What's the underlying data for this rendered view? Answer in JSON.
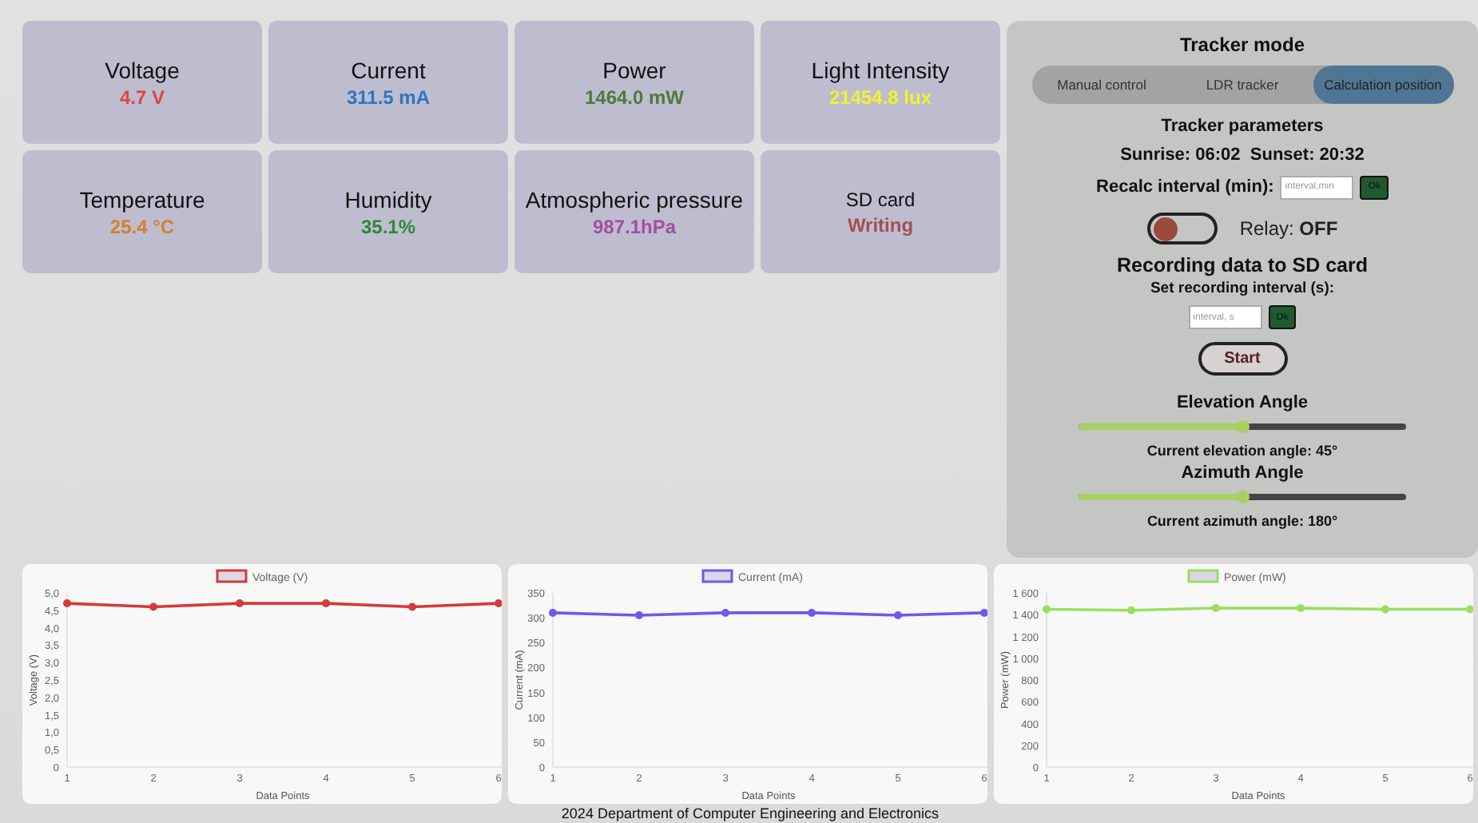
{
  "metrics": [
    {
      "label": "Voltage",
      "value": "4.7 V",
      "color": "#e04444"
    },
    {
      "label": "Current",
      "value": "311.5 mA",
      "color": "#2f74c4"
    },
    {
      "label": "Power",
      "value": "1464.0 mW",
      "color": "#4f7a3f"
    },
    {
      "label": "Light Intensity",
      "value": "21454.8 lux",
      "color": "#f2f230"
    },
    {
      "label": "Temperature",
      "value": "25.4 °C",
      "color": "#d5802a"
    },
    {
      "label": "Humidity",
      "value": "35.1%",
      "color": "#2e8a32"
    },
    {
      "label": "Atmospheric pressure",
      "value": "987.1hPa",
      "color": "#a44ea4"
    },
    {
      "label": "SD card",
      "value": "Writing",
      "color": "#a45050"
    }
  ],
  "tracker": {
    "title": "Tracker mode",
    "tabs": [
      {
        "label": "Manual control",
        "selected": false
      },
      {
        "label": "LDR tracker",
        "selected": false
      },
      {
        "label": "Calculation position",
        "selected": true
      }
    ],
    "parameters_title": "Tracker parameters",
    "sun_times": "Sunrise: 06:02  Sunset: 20:32",
    "recalc": {
      "label": "Recalc interval (min):",
      "placeholder": "interval,min",
      "button": "Ok"
    },
    "relay": {
      "label": "Relay:",
      "state": "OFF",
      "on": false
    },
    "recording_title": "Recording data to SD card",
    "recording": {
      "label": "Set recording interval (s):",
      "placeholder": "interval, s",
      "button": "Ok"
    },
    "start_button": "Start",
    "angles": [
      {
        "title": "Elevation Angle",
        "level": 0.5,
        "reading": "Current elevation angle: 45°"
      },
      {
        "title": "Azimuth Angle",
        "level": 0.5,
        "reading": "Current azimuth angle: 180°"
      }
    ]
  },
  "charts": [
    {
      "chart_data": {
        "type": "line",
        "xlabel": "Data Points",
        "ylabel": "Voltage (V)",
        "categories": [
          "1",
          "2",
          "3",
          "4",
          "5",
          "6"
        ],
        "ylim": [
          0,
          5
        ],
        "yticks": [
          {
            "value": 0,
            "label": "0"
          },
          {
            "value": 0.5,
            "label": "0,5"
          },
          {
            "value": 1,
            "label": "1,0"
          },
          {
            "value": 1.5,
            "label": "1,5"
          },
          {
            "value": 2,
            "label": "2,0"
          },
          {
            "value": 2.5,
            "label": "2,5"
          },
          {
            "value": 3,
            "label": "3,0"
          },
          {
            "value": 3.5,
            "label": "3,5"
          },
          {
            "value": 4,
            "label": "4,0"
          },
          {
            "value": 4.5,
            "label": "4,5"
          },
          {
            "value": 5,
            "label": "5,0"
          }
        ],
        "series": [
          {
            "name": "Voltage (V)",
            "color": "#d63a3a",
            "marker": "circle",
            "values": [
              4.7,
              4.6,
              4.7,
              4.7,
              4.6,
              4.7
            ]
          }
        ]
      }
    },
    {
      "chart_data": {
        "type": "line",
        "xlabel": "Data Points",
        "ylabel": "Current (mA)",
        "categories": [
          "1",
          "2",
          "3",
          "4",
          "5",
          "6"
        ],
        "ylim": [
          0,
          350
        ],
        "yticks": [
          0,
          50,
          100,
          150,
          200,
          250,
          300,
          350
        ],
        "series": [
          {
            "name": "Current (mA)",
            "color": "#6a5af0",
            "marker": "circle",
            "values": [
              310,
              305,
              310,
              310,
              305,
              310
            ]
          }
        ]
      }
    },
    {
      "chart_data": {
        "type": "line",
        "xlabel": "Data Points",
        "ylabel": "Power (mW)",
        "categories": [
          "1",
          "2",
          "3",
          "4",
          "5",
          "6"
        ],
        "ylim": [
          0,
          1600
        ],
        "yticks": [
          {
            "value": 0,
            "label": "0"
          },
          {
            "value": 200,
            "label": "200"
          },
          {
            "value": 400,
            "label": "400"
          },
          {
            "value": 600,
            "label": "600"
          },
          {
            "value": 800,
            "label": "800"
          },
          {
            "value": 1000,
            "label": "1 000"
          },
          {
            "value": 1200,
            "label": "1 200"
          },
          {
            "value": 1400,
            "label": "1 400"
          },
          {
            "value": 1600,
            "label": "1 600"
          }
        ],
        "series": [
          {
            "name": "Power (mW)",
            "color": "#98e060",
            "marker": "circle",
            "values": [
              1450,
              1440,
              1460,
              1460,
              1450,
              1450
            ]
          }
        ]
      }
    }
  ],
  "footer": "2024 Department of Computer Engineering and Electronics"
}
